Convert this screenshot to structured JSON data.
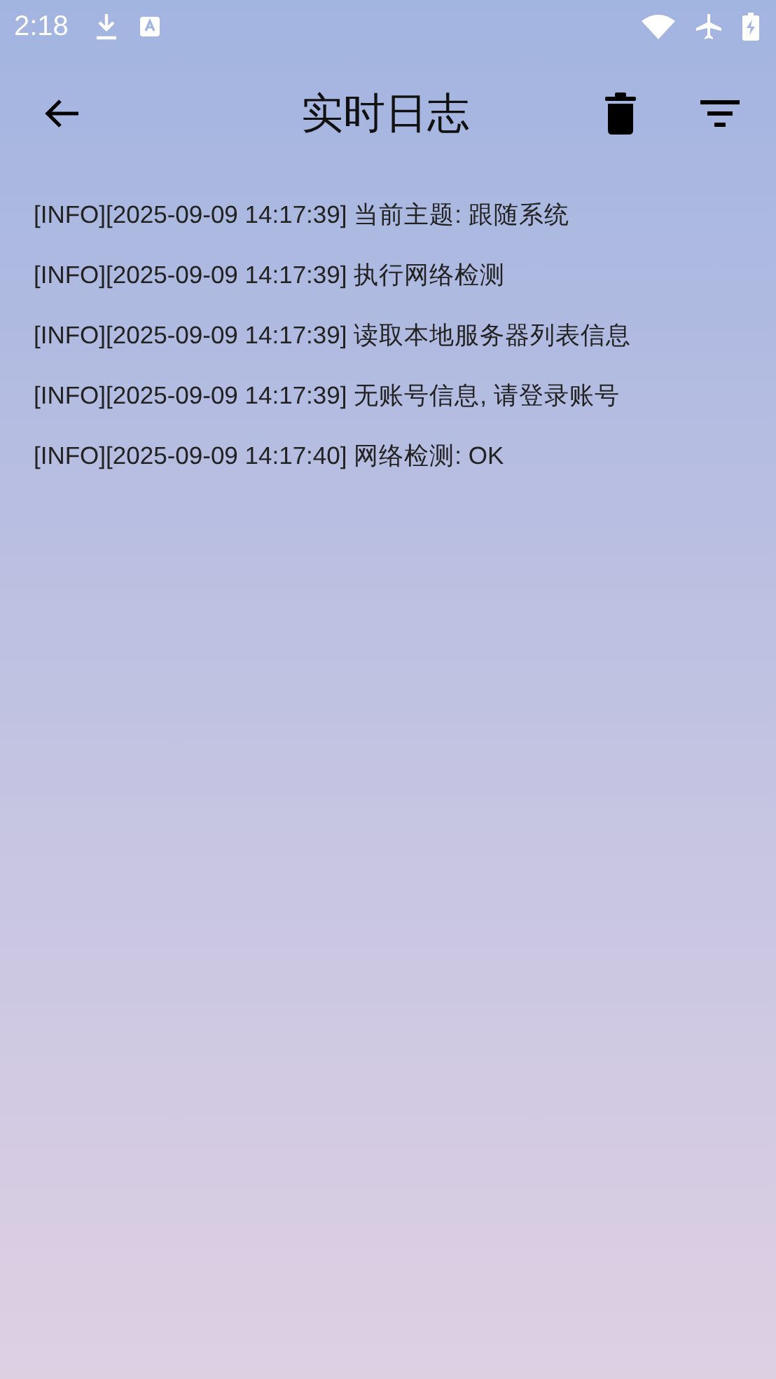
{
  "status_bar": {
    "time": "2:18"
  },
  "app_bar": {
    "title": "实时日志"
  },
  "log": [
    {
      "text": "[INFO][2025-09-09 14:17:39] 当前主题: 跟随系统"
    },
    {
      "text": "[INFO][2025-09-09 14:17:39] 执行网络检测"
    },
    {
      "text": "[INFO][2025-09-09 14:17:39] 读取本地服务器列表信息"
    },
    {
      "text": "[INFO][2025-09-09 14:17:39] 无账号信息, 请登录账号"
    },
    {
      "text": "[INFO][2025-09-09 14:17:40] 网络检测: OK"
    }
  ]
}
